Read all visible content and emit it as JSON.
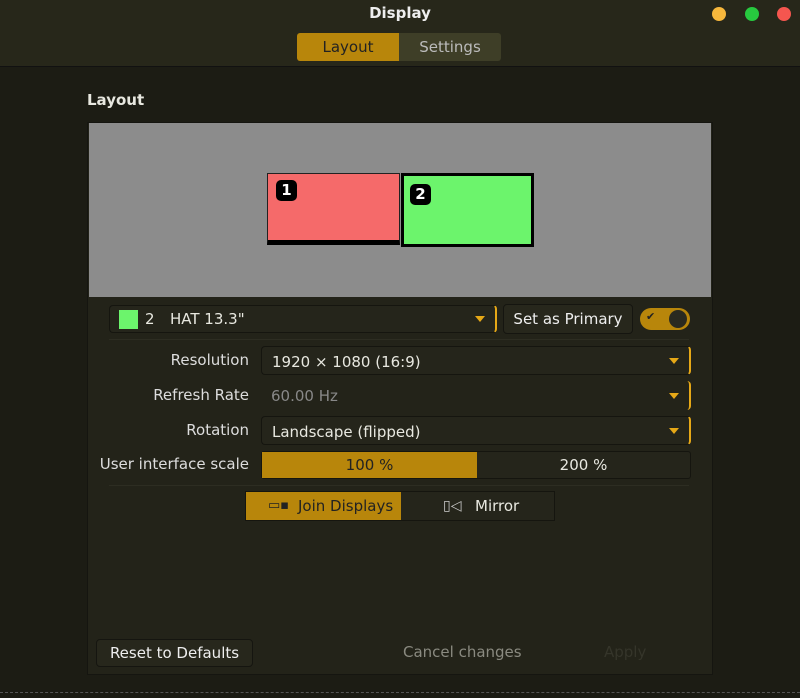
{
  "window": {
    "title": "Display",
    "tabs": [
      "Layout",
      "Settings"
    ]
  },
  "section_title": "Layout",
  "monitors": [
    {
      "number": "1",
      "color": "#f56a6a"
    },
    {
      "number": "2",
      "color": "#6cf46c"
    }
  ],
  "display_select": {
    "number": "2",
    "name": "HAT 13.3\"",
    "color": "#6cf46c"
  },
  "set_primary": "Set as Primary",
  "primary_toggle": {
    "on": true
  },
  "rows": {
    "resolution": {
      "label": "Resolution",
      "value": "1920 × 1080 (16:9)"
    },
    "refresh": {
      "label": "Refresh Rate",
      "value": "60.00 Hz"
    },
    "rotation": {
      "label": "Rotation",
      "value": "Landscape (flipped)"
    },
    "scale": {
      "label": "User interface scale",
      "options": [
        "100 %",
        "200 %"
      ],
      "selected": "100 %"
    }
  },
  "mode": {
    "join": "Join Displays",
    "mirror": "Mirror",
    "selected": "Join Displays"
  },
  "footer": {
    "reset": "Reset to Defaults",
    "cancel": "Cancel changes",
    "apply": "Apply"
  },
  "colors": {
    "accent": "#b8860b"
  }
}
